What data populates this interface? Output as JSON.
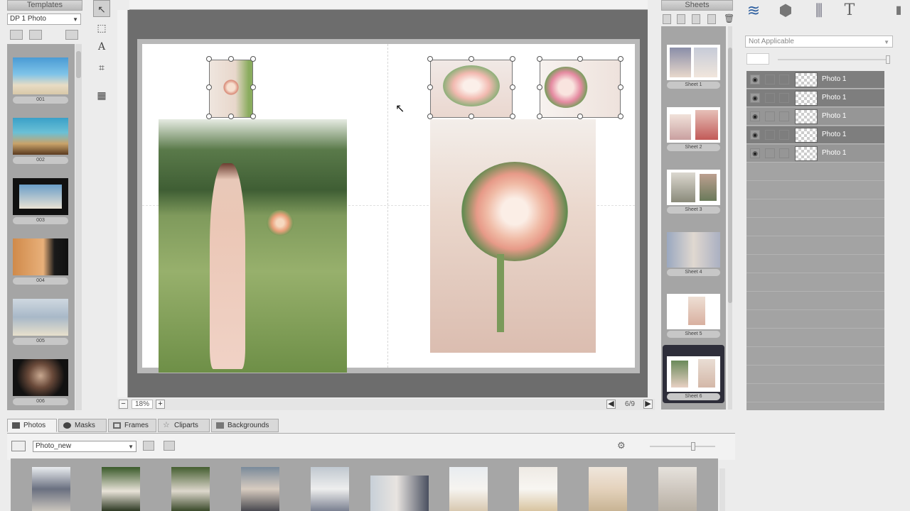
{
  "templates": {
    "title": "Templates",
    "selected": "DP 1 Photo",
    "items": [
      {
        "label": "001"
      },
      {
        "label": "002"
      },
      {
        "label": "003"
      },
      {
        "label": "004"
      },
      {
        "label": "005"
      },
      {
        "label": "006"
      }
    ]
  },
  "canvas": {
    "zoom": "18%",
    "page_indicator": "6/9"
  },
  "sheets": {
    "title": "Sheets",
    "items": [
      {
        "label": "Sheet 1"
      },
      {
        "label": "Sheet 2"
      },
      {
        "label": "Sheet 3"
      },
      {
        "label": "Sheet 4"
      },
      {
        "label": "Sheet 5"
      },
      {
        "label": "Sheet 6"
      }
    ]
  },
  "layers_panel": {
    "blend_mode": "Not Applicable",
    "layers": [
      {
        "name": "Photo 1"
      },
      {
        "name": "Photo 1"
      },
      {
        "name": "Photo 1"
      },
      {
        "name": "Photo 1"
      },
      {
        "name": "Photo 1"
      }
    ]
  },
  "bottom": {
    "tabs": [
      {
        "label": "Photos"
      },
      {
        "label": "Masks"
      },
      {
        "label": "Frames"
      },
      {
        "label": "Cliparts"
      },
      {
        "label": "Backgrounds"
      }
    ],
    "folder": "Photo_new"
  },
  "colors": {
    "panel_bg": "#a5a5a5",
    "canvas_bg": "#6d6d6d",
    "layer_active": "#7e7e7e",
    "tab_icon": "#4a6fa5"
  }
}
